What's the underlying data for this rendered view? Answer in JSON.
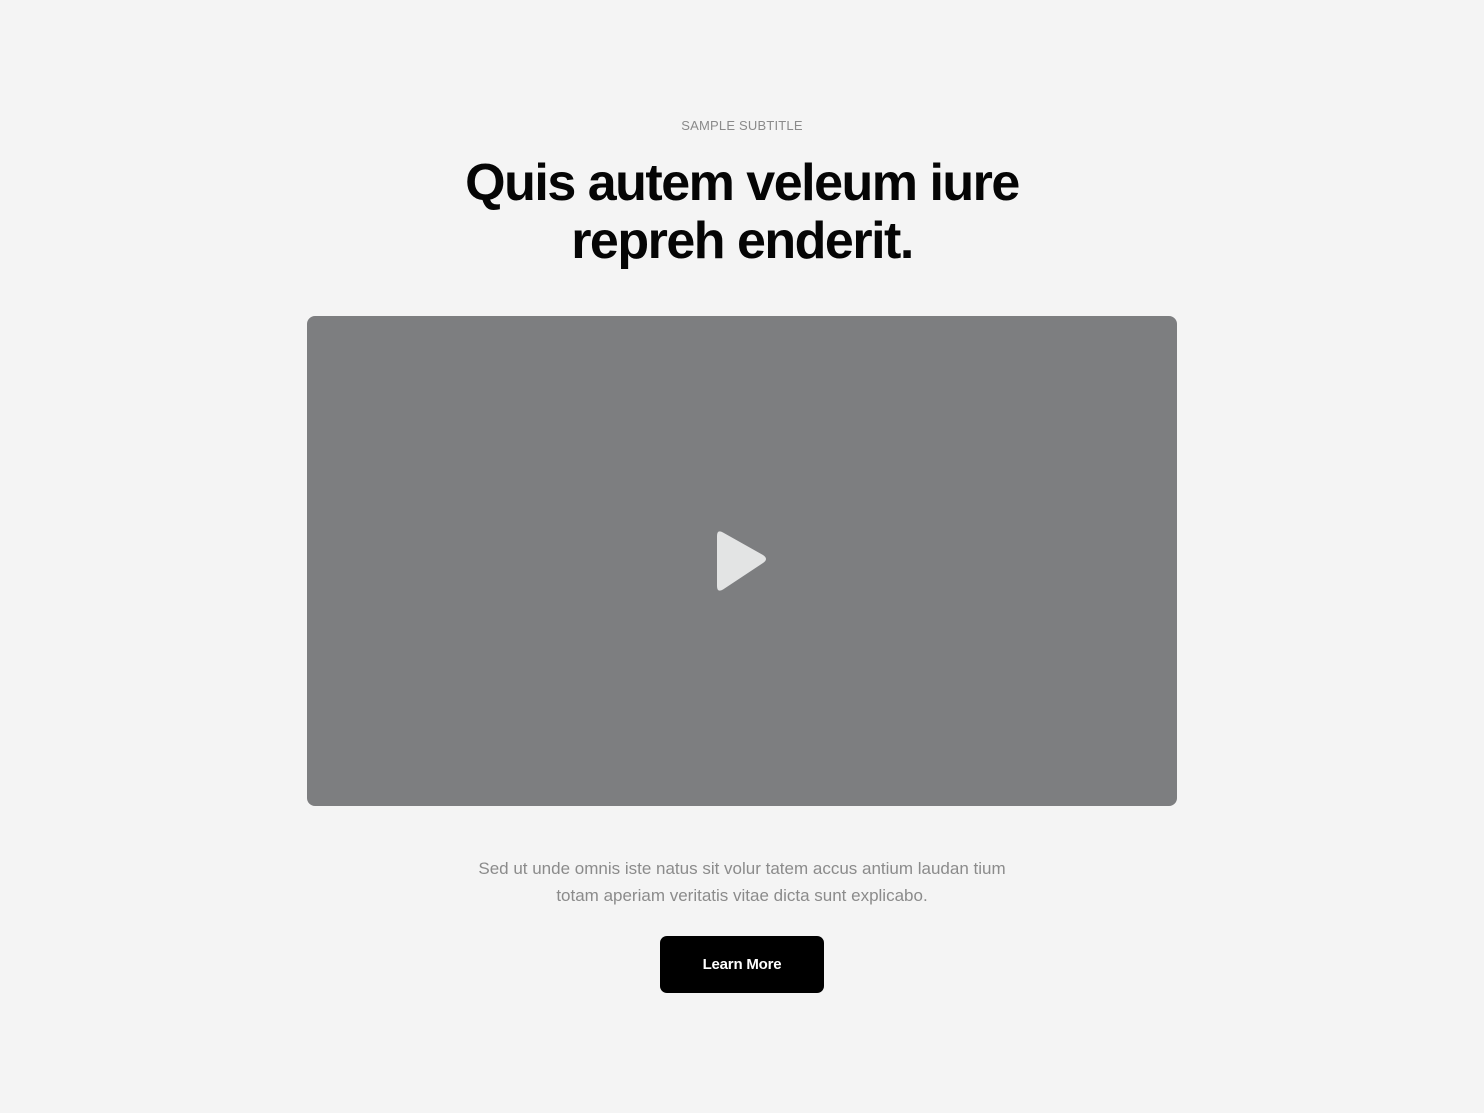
{
  "hero": {
    "subtitle": "SAMPLE SUBTITLE",
    "title_line1": "Quis autem veleum iure",
    "title_line2": "repreh enderit."
  },
  "video": {
    "play_icon": "play-icon",
    "background_color": "#7d7e80",
    "icon_color": "#e3e4e4"
  },
  "content": {
    "description_line1": "Sed ut unde omnis iste natus sit volur tatem accus antium laudan tium",
    "description_line2": "totam aperiam veritatis vitae dicta sunt explicabo."
  },
  "cta": {
    "label": "Learn More",
    "background_color": "#000000",
    "text_color": "#ffffff"
  },
  "page": {
    "background_color": "#f4f4f4"
  }
}
